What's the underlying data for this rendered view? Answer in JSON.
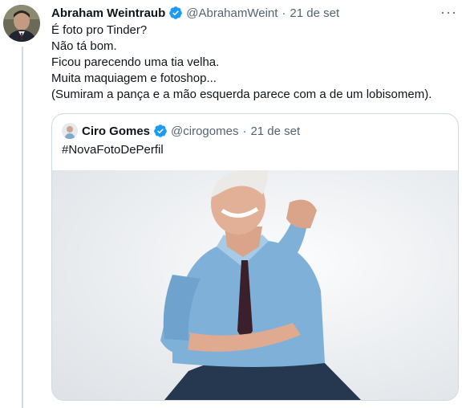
{
  "tweet": {
    "author_name": "Abraham Weintraub",
    "author_handle": "@AbrahamWeint",
    "separator": "·",
    "date": "21 de set",
    "more_label": "···",
    "lines": [
      "É foto pro Tinder?",
      "Não tá bom.",
      "Ficou parecendo uma tia velha.",
      "Muita maquiagem e fotoshop...",
      "(Sumiram a pança e a mão esquerda parece com a de um lobisomem)."
    ]
  },
  "quoted": {
    "author_name": "Ciro Gomes",
    "author_handle": "@cirogomes",
    "separator": "·",
    "date": "21 de set",
    "text": "#NovaFotoDePerfil"
  },
  "colors": {
    "verified": "#1d9bf0",
    "muted_text": "#536471",
    "border": "#cfd9de"
  },
  "icons": [
    "verified-badge-icon",
    "more-options-icon"
  ]
}
